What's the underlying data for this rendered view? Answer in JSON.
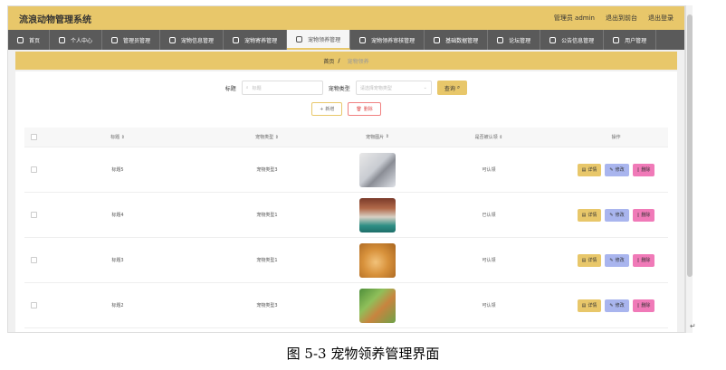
{
  "app_title": "流浪动物管理系统",
  "header": {
    "admin_label": "管理员 admin",
    "back_link": "退出到前台",
    "logout_link": "退出登录"
  },
  "nav": [
    {
      "label": "首页",
      "icon": "home-icon"
    },
    {
      "label": "个人中心",
      "icon": "user-icon"
    },
    {
      "label": "管理员管理",
      "icon": "list-icon"
    },
    {
      "label": "宠物信息管理",
      "icon": "list-icon"
    },
    {
      "label": "宠物寄养管理",
      "icon": "list-icon"
    },
    {
      "label": "宠物领养管理",
      "icon": "list-icon",
      "active": true
    },
    {
      "label": "宠物领养审核管理",
      "icon": "user-icon"
    },
    {
      "label": "基础数据管理",
      "icon": "list-icon"
    },
    {
      "label": "论坛管理",
      "icon": "list-icon"
    },
    {
      "label": "公告信息管理",
      "icon": "list-icon"
    },
    {
      "label": "用户管理",
      "icon": "list-icon"
    }
  ],
  "breadcrumb": {
    "home": "首页",
    "separator": "/",
    "current": "宠物领养"
  },
  "search": {
    "title_label": "标题",
    "title_placeholder": "标题",
    "type_label": "宠物类型",
    "type_placeholder": "请选择宠物类型",
    "search_button": "查询"
  },
  "actions": {
    "add": "新增",
    "delete": "删除"
  },
  "table": {
    "headers": [
      "标题",
      "宠物类型",
      "宠物图片",
      "是否被认领",
      "操作"
    ],
    "rows": [
      {
        "title": "标题5",
        "type": "宠物类型3",
        "status": "可认领",
        "image": "cat-white"
      },
      {
        "title": "标题4",
        "type": "宠物类型1",
        "status": "已认领",
        "image": "dog-teal"
      },
      {
        "title": "标题3",
        "type": "宠物类型1",
        "status": "可认领",
        "image": "dog-golden"
      },
      {
        "title": "标题2",
        "type": "宠物类型3",
        "status": "可认领",
        "image": "dog-green"
      }
    ],
    "row_buttons": {
      "detail": "详情",
      "edit": "修改",
      "delete": "删除"
    }
  },
  "caption": "图 5-3 宠物领养管理界面",
  "colors": {
    "accent": "#e8c76a",
    "nav_bg": "#5a5a5a",
    "edit": "#a9b5ee",
    "delete": "#f07ab8"
  }
}
